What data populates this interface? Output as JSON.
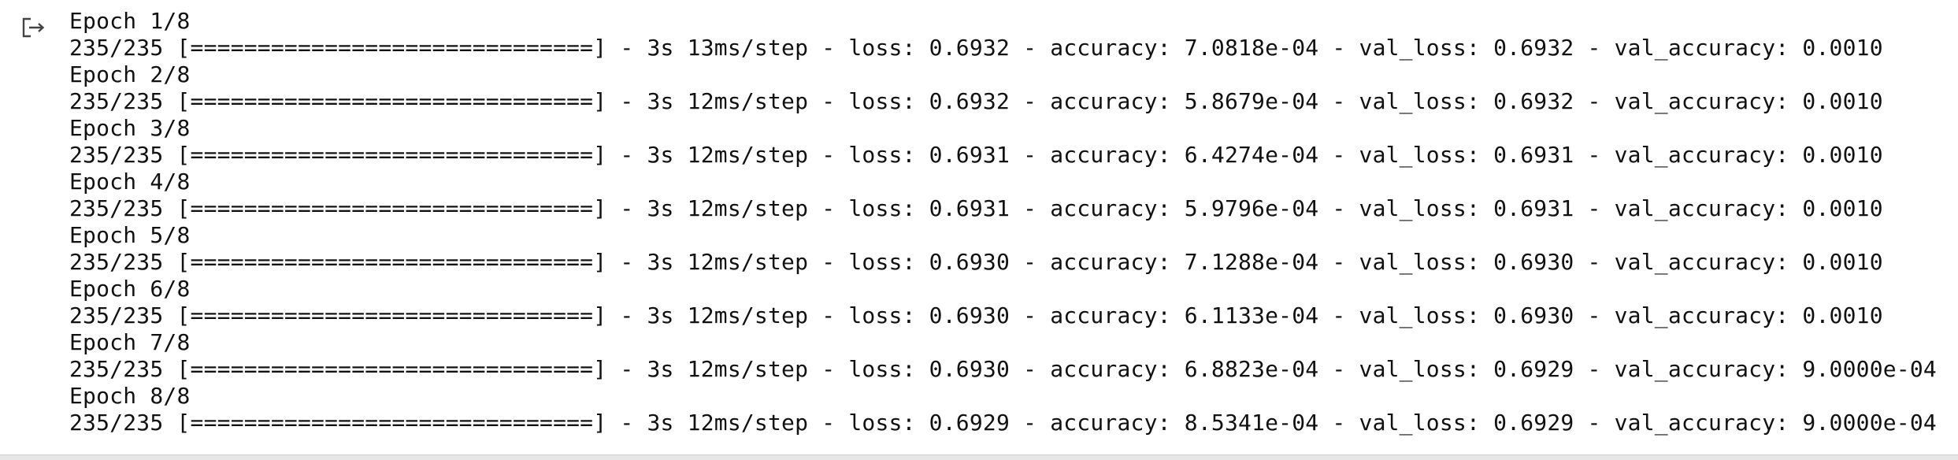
{
  "output": {
    "icon": "output-redirect-icon",
    "lines": [
      "Epoch 1/8",
      "235/235 [==============================] - 3s 13ms/step - loss: 0.6932 - accuracy: 7.0818e-04 - val_loss: 0.6932 - val_accuracy: 0.0010",
      "Epoch 2/8",
      "235/235 [==============================] - 3s 12ms/step - loss: 0.6932 - accuracy: 5.8679e-04 - val_loss: 0.6932 - val_accuracy: 0.0010",
      "Epoch 3/8",
      "235/235 [==============================] - 3s 12ms/step - loss: 0.6931 - accuracy: 6.4274e-04 - val_loss: 0.6931 - val_accuracy: 0.0010",
      "Epoch 4/8",
      "235/235 [==============================] - 3s 12ms/step - loss: 0.6931 - accuracy: 5.9796e-04 - val_loss: 0.6931 - val_accuracy: 0.0010",
      "Epoch 5/8",
      "235/235 [==============================] - 3s 12ms/step - loss: 0.6930 - accuracy: 7.1288e-04 - val_loss: 0.6930 - val_accuracy: 0.0010",
      "Epoch 6/8",
      "235/235 [==============================] - 3s 12ms/step - loss: 0.6930 - accuracy: 6.1133e-04 - val_loss: 0.6930 - val_accuracy: 0.0010",
      "Epoch 7/8",
      "235/235 [==============================] - 3s 12ms/step - loss: 0.6930 - accuracy: 6.8823e-04 - val_loss: 0.6929 - val_accuracy: 9.0000e-04",
      "Epoch 8/8",
      "235/235 [==============================] - 3s 12ms/step - loss: 0.6929 - accuracy: 8.5341e-04 - val_loss: 0.6929 - val_accuracy: 9.0000e-04"
    ]
  }
}
